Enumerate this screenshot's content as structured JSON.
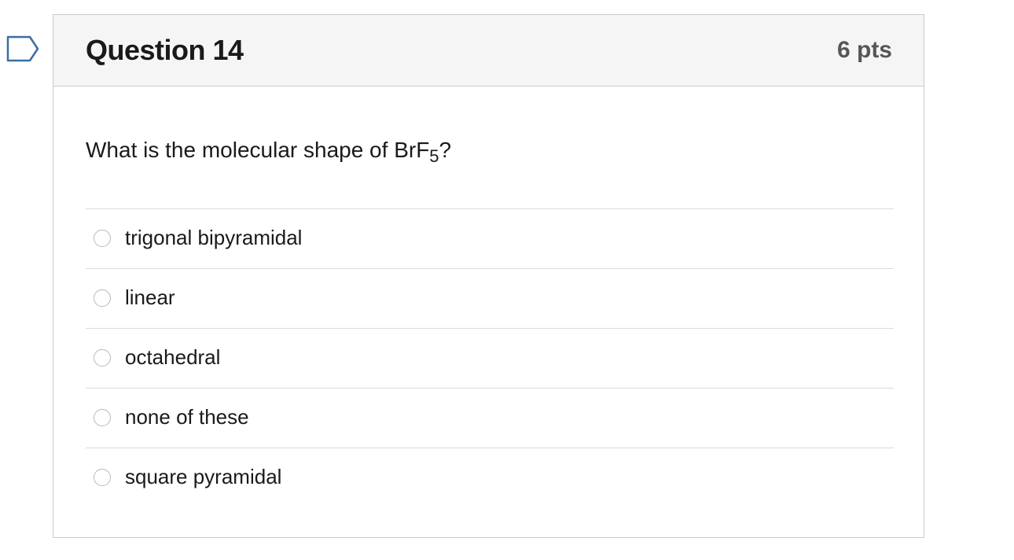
{
  "question": {
    "title": "Question 14",
    "points": "6 pts",
    "text_prefix": "What is the molecular shape of BrF",
    "text_subscript": "5",
    "text_suffix": "?"
  },
  "answers": [
    {
      "label": "trigonal bipyramidal",
      "selected": false
    },
    {
      "label": "linear",
      "selected": false
    },
    {
      "label": "octahedral",
      "selected": false
    },
    {
      "label": "none of these",
      "selected": false
    },
    {
      "label": "square pyramidal",
      "selected": false
    }
  ],
  "flag": {
    "icon": "flag-question-icon",
    "color": "#2d6aa8"
  }
}
